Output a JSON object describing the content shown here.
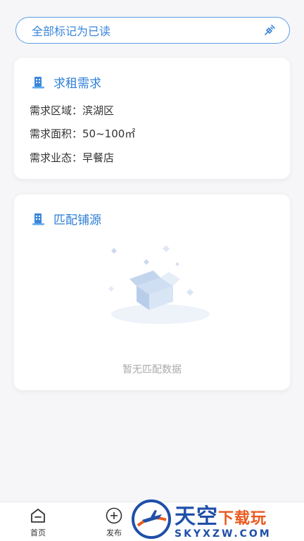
{
  "header": {
    "mark_all_read_label": "全部标记为已读",
    "mark_icon": "broom-icon"
  },
  "requirement_card": {
    "title": "求租需求",
    "fields": [
      {
        "key": "需求区域：",
        "value": "滨湖区"
      },
      {
        "key": "需求面积：",
        "value": "50~100㎡"
      },
      {
        "key": "需求业态：",
        "value": "早餐店"
      }
    ]
  },
  "match_card": {
    "title": "匹配铺源",
    "empty_text": "暂无匹配数据"
  },
  "tabbar": {
    "home_label": "首页",
    "publish_label": "发布"
  },
  "watermark": {
    "cn_main": "天空",
    "cn_sub": "下载玩",
    "en": "SKYXZW.COM"
  },
  "colors": {
    "accent": "#3a86db",
    "title_blue": "#2f7fd6",
    "background": "#f6f6f8"
  }
}
